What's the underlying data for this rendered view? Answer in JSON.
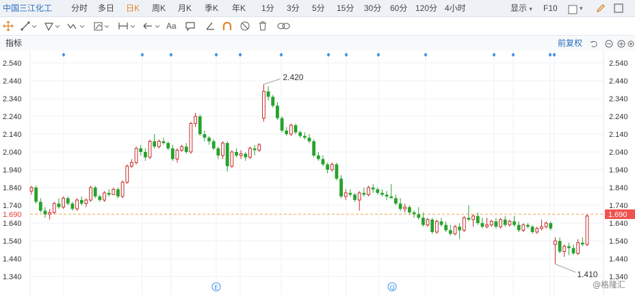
{
  "stock_name": "中国三江化工",
  "periods": [
    "分时",
    "多日",
    "日K",
    "周K",
    "月K",
    "季K",
    "年K",
    "1分",
    "3分",
    "5分",
    "15分",
    "30分",
    "60分",
    "120分",
    "4小时"
  ],
  "active_period": "日K",
  "display_label": "显示",
  "f10_label": "F10",
  "indicator_label": "指标",
  "adjust_label": "前复权",
  "font_tool_label": "Aa",
  "watermark": "@格隆汇",
  "current_price": "1.690",
  "high_label": "2.420",
  "low_label": "1.410",
  "y_labels": [
    "2.540",
    "2.440",
    "2.340",
    "2.240",
    "2.140",
    "2.040",
    "1.940",
    "1.840",
    "1.740",
    "1.640",
    "1.540",
    "1.440",
    "1.340"
  ],
  "event_markers": [
    "Ⓔ",
    "Ⓠ"
  ],
  "colors": {
    "up": "#c62828",
    "down": "#26a22c",
    "accent": "#e0822b",
    "link": "#2a6ebb",
    "price_line": "#f0a040"
  },
  "chart_data": {
    "type": "candlestick",
    "ylim": [
      1.29,
      2.59
    ],
    "current_price": 1.69,
    "high": 2.42,
    "low": 1.41,
    "candles": [
      [
        1.82,
        1.85,
        1.8,
        1.84
      ],
      [
        1.84,
        1.85,
        1.75,
        1.76
      ],
      [
        1.76,
        1.78,
        1.7,
        1.71
      ],
      [
        1.71,
        1.73,
        1.67,
        1.69
      ],
      [
        1.69,
        1.72,
        1.66,
        1.7
      ],
      [
        1.7,
        1.76,
        1.69,
        1.75
      ],
      [
        1.75,
        1.78,
        1.72,
        1.73
      ],
      [
        1.73,
        1.79,
        1.72,
        1.78
      ],
      [
        1.78,
        1.79,
        1.74,
        1.75
      ],
      [
        1.75,
        1.76,
        1.71,
        1.72
      ],
      [
        1.72,
        1.78,
        1.71,
        1.77
      ],
      [
        1.77,
        1.79,
        1.74,
        1.75
      ],
      [
        1.75,
        1.78,
        1.73,
        1.77
      ],
      [
        1.77,
        1.85,
        1.76,
        1.84
      ],
      [
        1.84,
        1.85,
        1.78,
        1.79
      ],
      [
        1.79,
        1.8,
        1.76,
        1.77
      ],
      [
        1.77,
        1.82,
        1.76,
        1.81
      ],
      [
        1.81,
        1.83,
        1.79,
        1.8
      ],
      [
        1.8,
        1.84,
        1.8,
        1.83
      ],
      [
        1.83,
        1.84,
        1.78,
        1.79
      ],
      [
        1.79,
        1.88,
        1.78,
        1.87
      ],
      [
        1.87,
        1.97,
        1.86,
        1.96
      ],
      [
        1.96,
        2.0,
        1.95,
        1.98
      ],
      [
        1.98,
        2.07,
        1.97,
        2.06
      ],
      [
        2.06,
        2.08,
        2.02,
        2.04
      ],
      [
        2.04,
        2.06,
        1.99,
        2.01
      ],
      [
        2.01,
        2.11,
        2.0,
        2.1
      ],
      [
        2.1,
        2.14,
        2.06,
        2.07
      ],
      [
        2.07,
        2.11,
        2.06,
        2.1
      ],
      [
        2.1,
        2.12,
        2.08,
        2.09
      ],
      [
        2.09,
        2.1,
        2.05,
        2.06
      ],
      [
        2.06,
        2.08,
        1.99,
        2.0
      ],
      [
        2.0,
        2.06,
        1.98,
        2.05
      ],
      [
        2.05,
        2.08,
        2.04,
        2.07
      ],
      [
        2.07,
        2.09,
        2.03,
        2.04
      ],
      [
        2.04,
        2.21,
        2.03,
        2.2
      ],
      [
        2.2,
        2.26,
        2.18,
        2.24
      ],
      [
        2.24,
        2.25,
        2.13,
        2.14
      ],
      [
        2.14,
        2.16,
        2.1,
        2.12
      ],
      [
        2.12,
        2.13,
        2.08,
        2.1
      ],
      [
        2.1,
        2.11,
        2.05,
        2.06
      ],
      [
        2.06,
        2.07,
        2.0,
        2.02
      ],
      [
        2.02,
        2.1,
        2.0,
        2.09
      ],
      [
        2.09,
        2.1,
        1.93,
        1.96
      ],
      [
        1.96,
        2.05,
        1.95,
        2.04
      ],
      [
        2.04,
        2.06,
        2.01,
        2.02
      ],
      [
        2.02,
        2.05,
        2.0,
        2.03
      ],
      [
        2.03,
        2.04,
        1.99,
        2.01
      ],
      [
        2.01,
        2.07,
        2.0,
        2.06
      ],
      [
        2.06,
        2.08,
        2.02,
        2.05
      ],
      [
        2.05,
        2.09,
        2.04,
        2.08
      ],
      [
        2.23,
        2.42,
        2.21,
        2.38
      ],
      [
        2.38,
        2.41,
        2.33,
        2.35
      ],
      [
        2.35,
        2.36,
        2.29,
        2.3
      ],
      [
        2.3,
        2.32,
        2.22,
        2.23
      ],
      [
        2.23,
        2.24,
        2.15,
        2.16
      ],
      [
        2.16,
        2.18,
        2.13,
        2.14
      ],
      [
        2.14,
        2.2,
        2.13,
        2.19
      ],
      [
        2.19,
        2.2,
        2.14,
        2.15
      ],
      [
        2.15,
        2.16,
        2.12,
        2.13
      ],
      [
        2.13,
        2.15,
        2.11,
        2.12
      ],
      [
        2.12,
        2.14,
        2.09,
        2.1
      ],
      [
        2.1,
        2.11,
        2.01,
        2.02
      ],
      [
        2.02,
        2.04,
        1.99,
        2.0
      ],
      [
        2.0,
        2.02,
        1.96,
        1.97
      ],
      [
        1.97,
        1.98,
        1.92,
        1.94
      ],
      [
        1.94,
        1.98,
        1.93,
        1.97
      ],
      [
        1.97,
        1.98,
        1.88,
        1.89
      ],
      [
        1.89,
        1.91,
        1.78,
        1.79
      ],
      [
        1.79,
        1.83,
        1.77,
        1.81
      ],
      [
        1.81,
        1.83,
        1.79,
        1.8
      ],
      [
        1.8,
        1.81,
        1.76,
        1.77
      ],
      [
        1.77,
        1.82,
        1.71,
        1.81
      ],
      [
        1.81,
        1.84,
        1.79,
        1.8
      ],
      [
        1.8,
        1.85,
        1.79,
        1.84
      ],
      [
        1.84,
        1.86,
        1.81,
        1.83
      ],
      [
        1.83,
        1.84,
        1.8,
        1.81
      ],
      [
        1.81,
        1.83,
        1.79,
        1.8
      ],
      [
        1.8,
        1.82,
        1.77,
        1.79
      ],
      [
        1.79,
        1.86,
        1.78,
        1.78
      ],
      [
        1.78,
        1.8,
        1.74,
        1.75
      ],
      [
        1.75,
        1.78,
        1.71,
        1.72
      ],
      [
        1.72,
        1.75,
        1.7,
        1.73
      ],
      [
        1.73,
        1.74,
        1.69,
        1.7
      ],
      [
        1.7,
        1.71,
        1.67,
        1.69
      ],
      [
        1.69,
        1.73,
        1.66,
        1.67
      ],
      [
        1.67,
        1.7,
        1.62,
        1.63
      ],
      [
        1.63,
        1.67,
        1.62,
        1.66
      ],
      [
        1.66,
        1.67,
        1.58,
        1.59
      ],
      [
        1.59,
        1.66,
        1.58,
        1.65
      ],
      [
        1.65,
        1.67,
        1.62,
        1.63
      ],
      [
        1.63,
        1.65,
        1.59,
        1.6
      ],
      [
        1.6,
        1.63,
        1.57,
        1.58
      ],
      [
        1.58,
        1.63,
        1.57,
        1.62
      ],
      [
        1.62,
        1.64,
        1.55,
        1.6
      ],
      [
        1.6,
        1.68,
        1.59,
        1.67
      ],
      [
        1.67,
        1.74,
        1.65,
        1.66
      ],
      [
        1.66,
        1.69,
        1.62,
        1.68
      ],
      [
        1.68,
        1.7,
        1.63,
        1.64
      ],
      [
        1.64,
        1.67,
        1.61,
        1.62
      ],
      [
        1.62,
        1.67,
        1.61,
        1.63
      ],
      [
        1.63,
        1.66,
        1.62,
        1.65
      ],
      [
        1.65,
        1.67,
        1.61,
        1.62
      ],
      [
        1.62,
        1.67,
        1.61,
        1.66
      ],
      [
        1.66,
        1.68,
        1.62,
        1.63
      ],
      [
        1.63,
        1.66,
        1.62,
        1.65
      ],
      [
        1.65,
        1.68,
        1.62,
        1.63
      ],
      [
        1.63,
        1.65,
        1.59,
        1.6
      ],
      [
        1.6,
        1.64,
        1.59,
        1.63
      ],
      [
        1.63,
        1.64,
        1.61,
        1.62
      ],
      [
        1.62,
        1.63,
        1.58,
        1.59
      ],
      [
        1.59,
        1.62,
        1.58,
        1.61
      ],
      [
        1.61,
        1.66,
        1.6,
        1.62
      ],
      [
        1.62,
        1.65,
        1.61,
        1.64
      ],
      [
        1.64,
        1.65,
        1.6,
        1.61
      ],
      [
        1.52,
        1.56,
        1.41,
        1.54
      ],
      [
        1.54,
        1.56,
        1.47,
        1.48
      ],
      [
        1.48,
        1.52,
        1.45,
        1.51
      ],
      [
        1.51,
        1.53,
        1.46,
        1.5
      ],
      [
        1.5,
        1.52,
        1.46,
        1.47
      ],
      [
        1.47,
        1.55,
        1.46,
        1.53
      ],
      [
        1.53,
        1.56,
        1.51,
        1.52
      ],
      [
        1.52,
        1.69,
        1.51,
        1.68
      ]
    ]
  }
}
